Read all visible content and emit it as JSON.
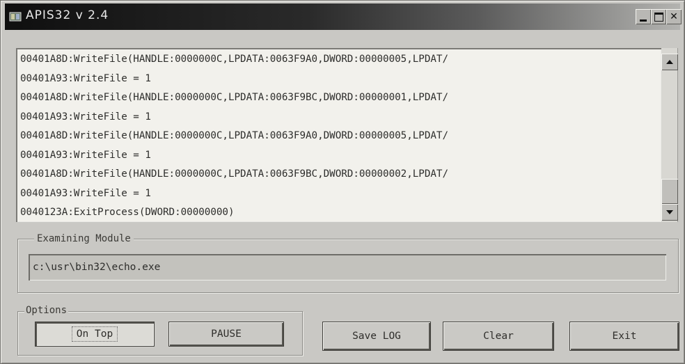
{
  "window": {
    "title": "APIS32 v 2.4",
    "icon": "app-icon",
    "controls": [
      "minimize-icon",
      "maximize-icon",
      "close-icon"
    ]
  },
  "log": {
    "lines": [
      "00401A8D:WriteFile(HANDLE:0000000C,LPDATA:0063F9A0,DWORD:00000005,LPDAT/",
      "00401A93:WriteFile = 1",
      "00401A8D:WriteFile(HANDLE:0000000C,LPDATA:0063F9BC,DWORD:00000001,LPDAT/",
      "00401A93:WriteFile = 1",
      "00401A8D:WriteFile(HANDLE:0000000C,LPDATA:0063F9A0,DWORD:00000005,LPDAT/",
      "00401A93:WriteFile = 1",
      "00401A8D:WriteFile(HANDLE:0000000C,LPDATA:0063F9BC,DWORD:00000002,LPDAT/",
      "00401A93:WriteFile = 1",
      "0040123A:ExitProcess(DWORD:00000000)"
    ]
  },
  "examining": {
    "label": "Examining Module",
    "path": "c:\\usr\\bin32\\echo.exe"
  },
  "options": {
    "label": "Options",
    "on_top": "On Top",
    "pause": "PAUSE"
  },
  "buttons": {
    "save_log": "Save LOG",
    "clear": "Clear",
    "exit": "Exit"
  }
}
